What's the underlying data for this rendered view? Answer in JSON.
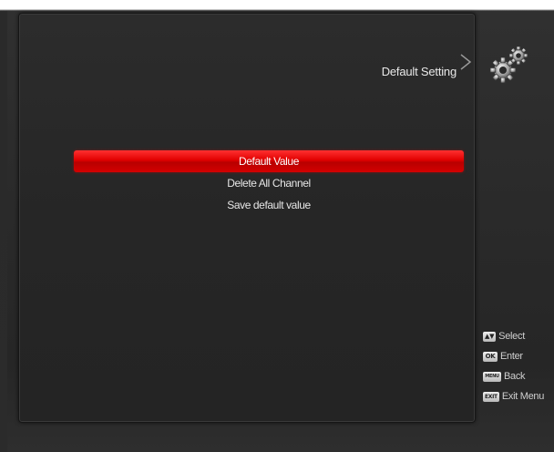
{
  "header": {
    "title": "Default Setting",
    "icon": "gear-icon"
  },
  "menu": {
    "items": [
      {
        "label": "Default Value",
        "selected": true
      },
      {
        "label": "Delete All Channel",
        "selected": false
      },
      {
        "label": "Save default value",
        "selected": false
      }
    ]
  },
  "help": {
    "rows": [
      {
        "key": "▲▼",
        "label": "Select",
        "icon": "up-down-key-icon"
      },
      {
        "key": "OK",
        "label": "Enter",
        "icon": "ok-key-icon"
      },
      {
        "key": "MENU",
        "label": "Back",
        "icon": "menu-key-icon"
      },
      {
        "key": "EXIT",
        "label": "Exit Menu",
        "icon": "exit-key-icon"
      }
    ]
  },
  "colors": {
    "selection": "#e00000",
    "background": "#2a2a2a",
    "text": "#e6e6e6"
  }
}
